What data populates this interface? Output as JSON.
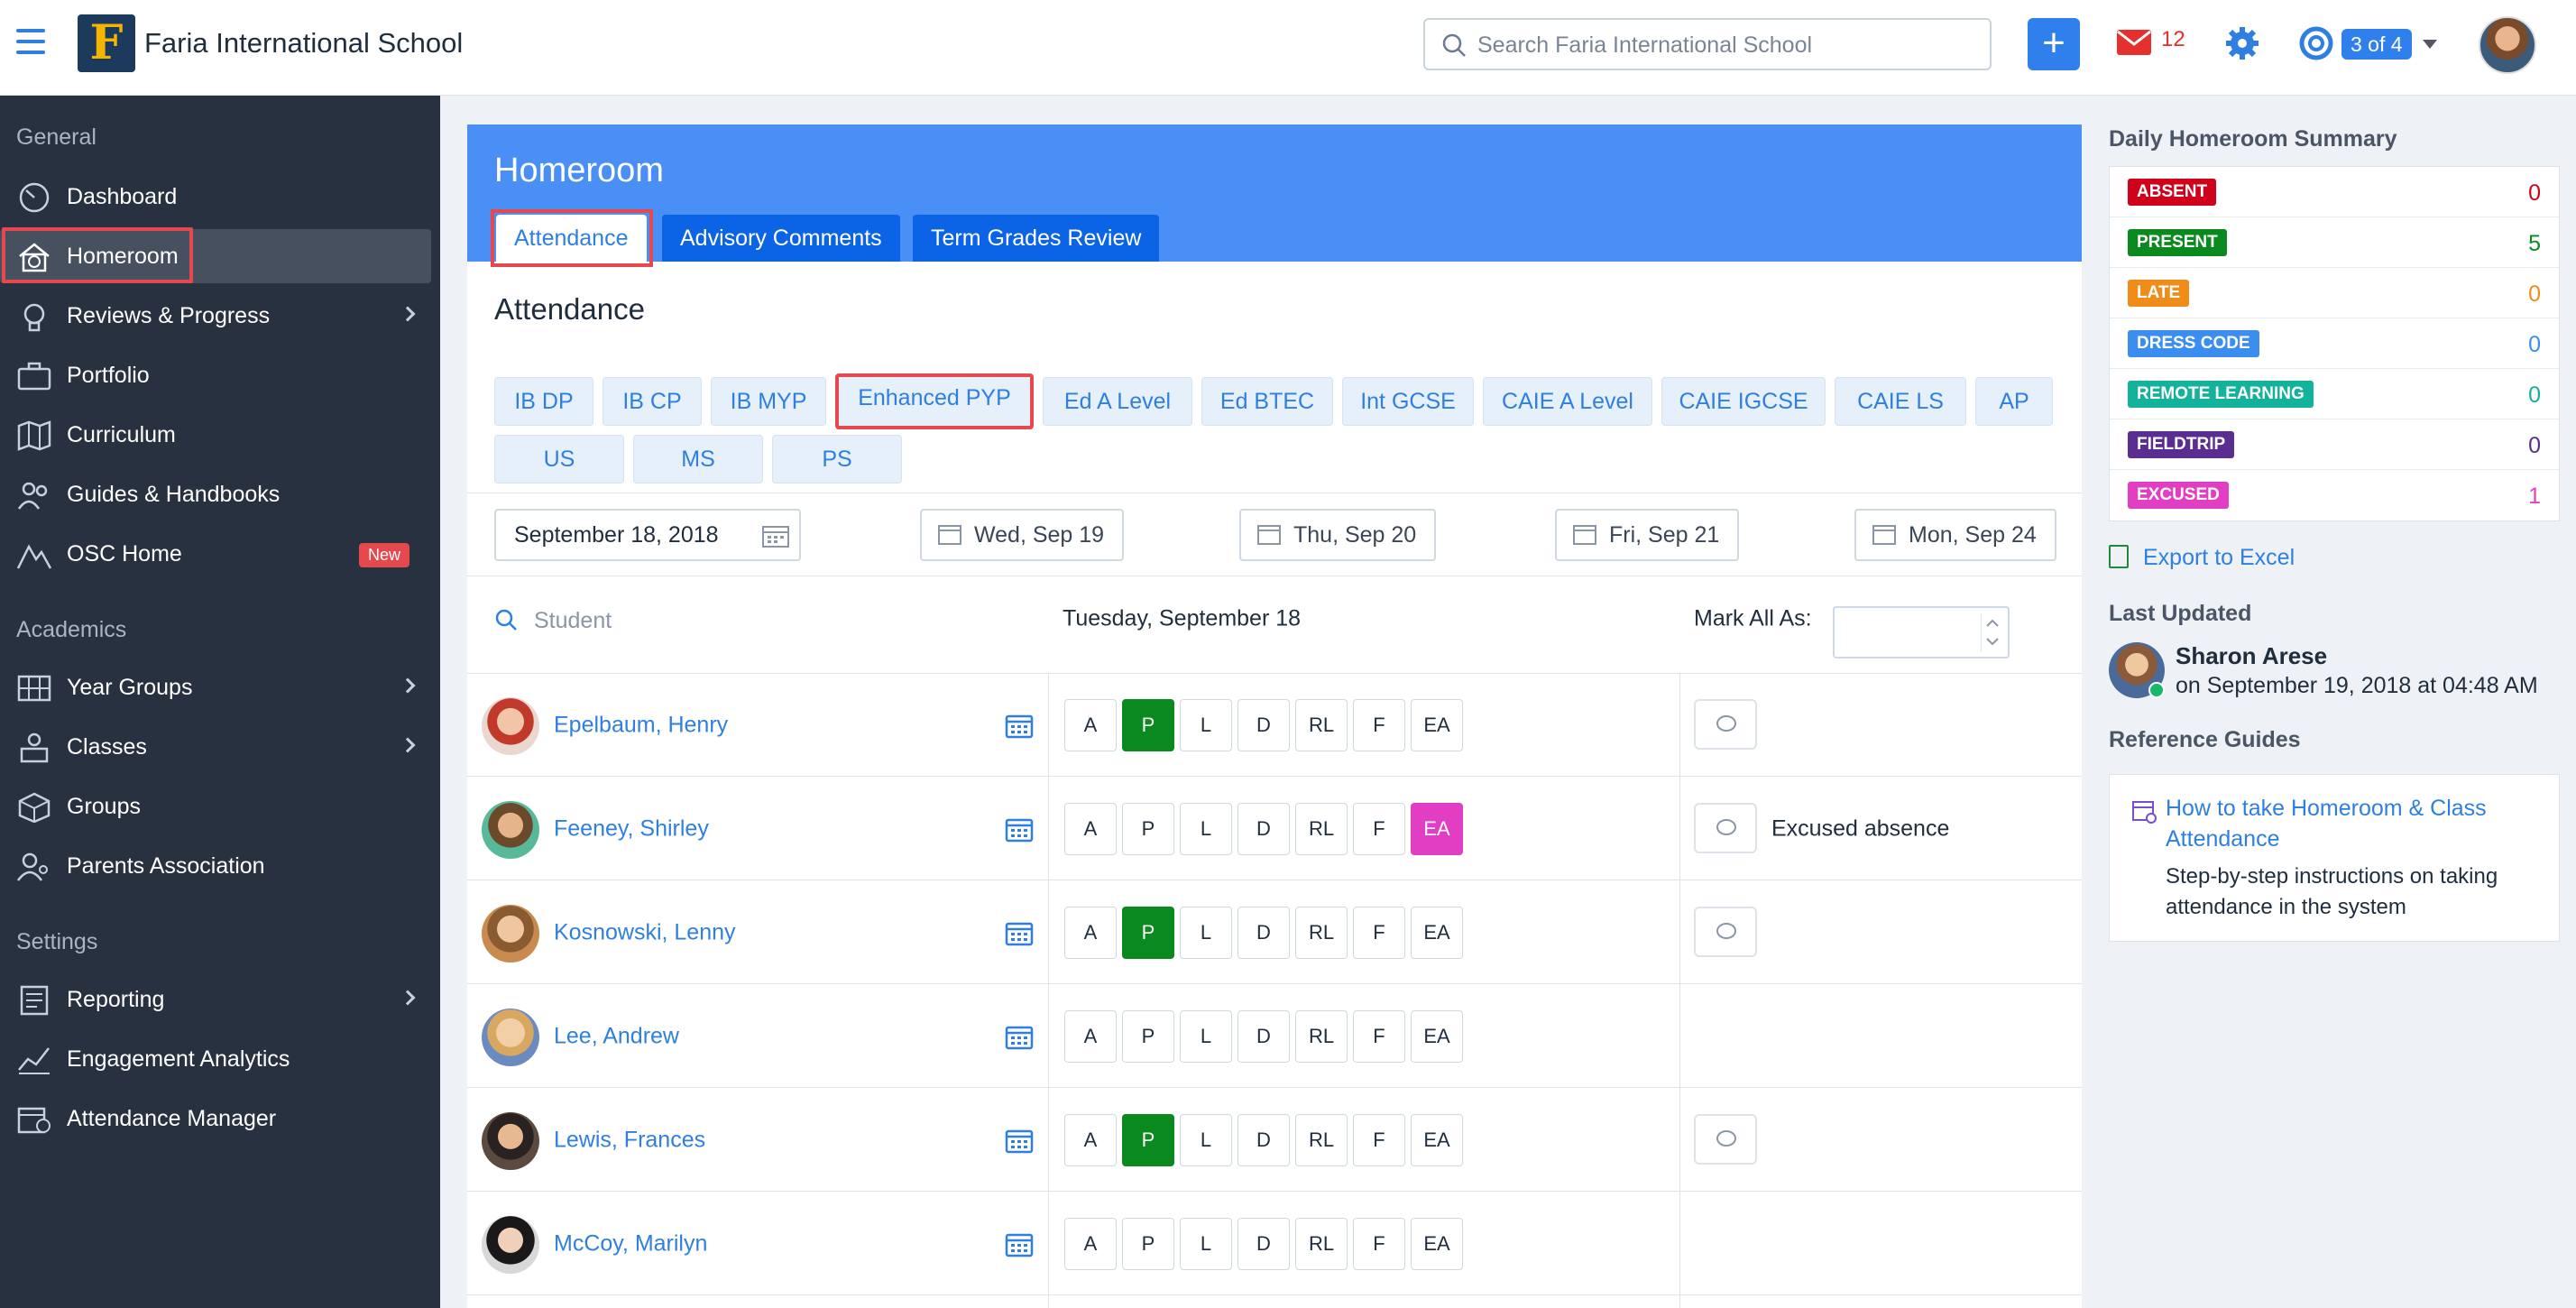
{
  "app": {
    "school_name": "Faria International School",
    "search_placeholder": "Search Faria International School",
    "mail_count": "12",
    "help_badge": "3 of 4"
  },
  "sidebar": {
    "sections": [
      "General",
      "Academics",
      "Settings"
    ],
    "items": [
      {
        "label": "Dashboard",
        "icon": "dashboard-icon"
      },
      {
        "label": "Homeroom",
        "icon": "clock-house-icon"
      },
      {
        "label": "Reviews & Progress",
        "icon": "lightbulb-icon"
      },
      {
        "label": "Portfolio",
        "icon": "briefcase-icon"
      },
      {
        "label": "Curriculum",
        "icon": "map-icon"
      },
      {
        "label": "Guides & Handbooks",
        "icon": "people-icon"
      },
      {
        "label": "OSC Home",
        "icon": "mountain-icon",
        "badge": "New"
      },
      {
        "label": "Year Groups",
        "icon": "year-groups-icon"
      },
      {
        "label": "Classes",
        "icon": "classes-icon"
      },
      {
        "label": "Groups",
        "icon": "cube-icon"
      },
      {
        "label": "Parents Association",
        "icon": "parents-icon"
      },
      {
        "label": "Reporting",
        "icon": "reporting-icon"
      },
      {
        "label": "Engagement Analytics",
        "icon": "analytics-icon"
      },
      {
        "label": "Attendance Manager",
        "icon": "calendar-clock-icon"
      }
    ]
  },
  "main": {
    "header_title": "Homeroom",
    "tabs": [
      "Attendance",
      "Advisory Comments",
      "Term Grades Review"
    ],
    "section_title": "Attendance",
    "programmes_row1": [
      "IB DP",
      "IB CP",
      "IB MYP",
      "Enhanced PYP",
      "Ed A Level",
      "Ed BTEC",
      "Int GCSE",
      "CAIE A Level",
      "CAIE IGCSE",
      "CAIE LS",
      "AP"
    ],
    "programmes_row2": [
      "US",
      "MS",
      "PS"
    ],
    "date_value": "September 18, 2018",
    "day_buttons": [
      "Wed, Sep 19",
      "Thu, Sep 20",
      "Fri, Sep 21",
      "Mon, Sep 24"
    ],
    "student_placeholder": "Student",
    "column_date": "Tuesday, September 18",
    "mark_all_label": "Mark All As:",
    "codes": [
      "A",
      "P",
      "L",
      "D",
      "RL",
      "F",
      "EA"
    ],
    "students": [
      {
        "name": "Epelbaum, Henry",
        "selected": "P",
        "comment_button": true,
        "comment": ""
      },
      {
        "name": "Feeney, Shirley",
        "selected": "EA",
        "comment_button": true,
        "comment": "Excused absence"
      },
      {
        "name": "Kosnowski, Lenny",
        "selected": "P",
        "comment_button": true,
        "comment": ""
      },
      {
        "name": "Lee, Andrew",
        "selected": "",
        "comment_button": false,
        "comment": ""
      },
      {
        "name": "Lewis, Frances",
        "selected": "P",
        "comment_button": true,
        "comment": ""
      },
      {
        "name": "McCoy, Marilyn",
        "selected": "",
        "comment_button": false,
        "comment": ""
      }
    ]
  },
  "right": {
    "summary_title": "Daily Homeroom Summary",
    "summary": [
      {
        "label": "ABSENT",
        "value": "0",
        "color": "#d0021b"
      },
      {
        "label": "PRESENT",
        "value": "5",
        "color": "#0a8a1e"
      },
      {
        "label": "LATE",
        "value": "0",
        "color": "#f08c1a"
      },
      {
        "label": "DRESS CODE",
        "value": "0",
        "color": "#3b8ef0"
      },
      {
        "label": "REMOTE LEARNING",
        "value": "0",
        "color": "#12b39a"
      },
      {
        "label": "FIELDTRIP",
        "value": "0",
        "color": "#5a2d91"
      },
      {
        "label": "EXCUSED",
        "value": "1",
        "color": "#e23ec4"
      }
    ],
    "export_label": "Export to Excel",
    "last_updated_title": "Last Updated",
    "updated_by": "Sharon Arese",
    "updated_time": "on September 19, 2018 at 04:48 AM",
    "reference_title": "Reference Guides",
    "guide_link": "How to take Homeroom & Class Attendance",
    "guide_desc": "Step-by-step instructions on taking attendance in the system"
  }
}
